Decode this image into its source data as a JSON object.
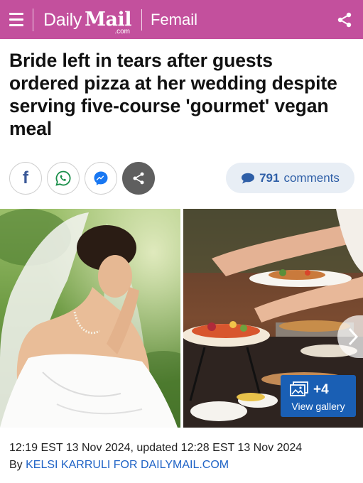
{
  "header": {
    "menu_icon": "hamburger-menu-icon",
    "logo_daily": "Daily",
    "logo_mail": "Mail",
    "logo_com": ".com",
    "section": "Femail",
    "share_icon": "share-icon",
    "background": "#c3509d"
  },
  "article": {
    "headline": "Bride left in tears after guests ordered pizza at her wedding despite serving five-course 'gourmet' vegan meal",
    "timestamp": "12:19 EST 13 Nov 2024, updated 12:28 EST 13 Nov 2024",
    "byline_prefix": "By ",
    "author": "KELSI KARRULI FOR DAILYMAIL.COM"
  },
  "social": {
    "buttons": [
      {
        "name": "facebook-icon"
      },
      {
        "name": "whatsapp-icon"
      },
      {
        "name": "messenger-icon"
      },
      {
        "name": "share-icon"
      }
    ],
    "facebook_glyph": "f",
    "comments_count": "791",
    "comments_label": "comments"
  },
  "gallery": {
    "extra_count": "+4",
    "label": "View gallery",
    "icon": "gallery-icon"
  },
  "colors": {
    "brand_pink": "#c3509d",
    "link_blue": "#1f63c6",
    "gallery_blue": "#1a5fb4"
  }
}
